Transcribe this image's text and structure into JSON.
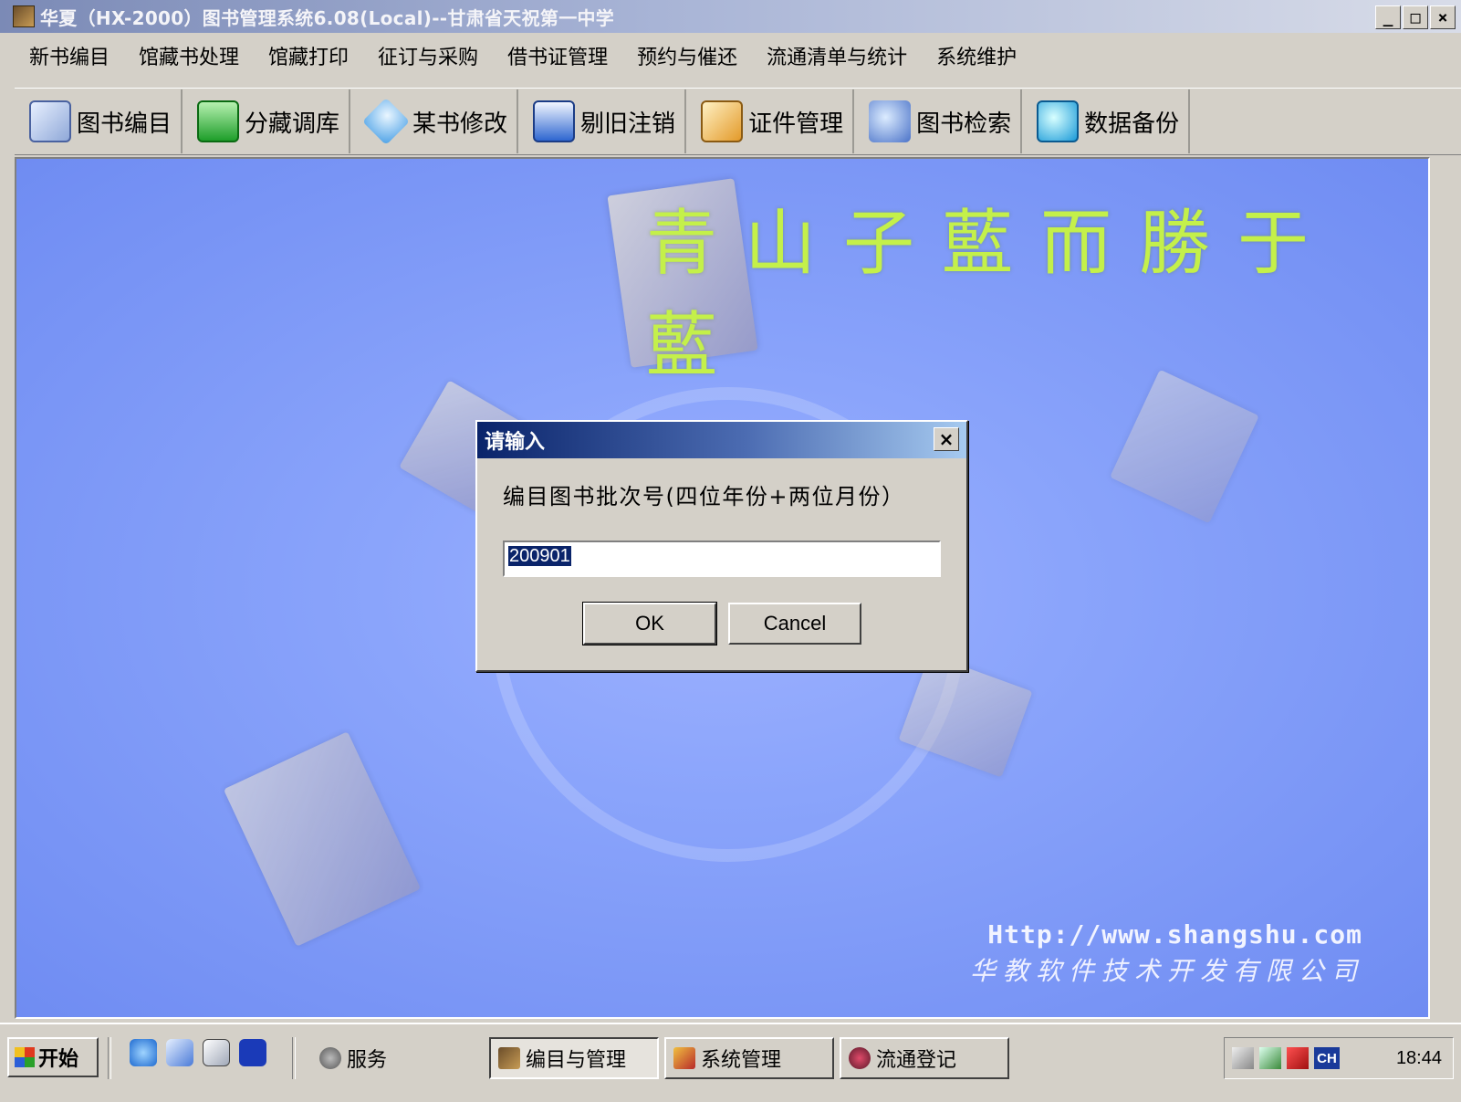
{
  "window": {
    "title": "华夏（HX-2000）图书管理系统6.08(Local)--甘肃省天祝第一中学",
    "min": "_",
    "max": "□",
    "close": "×"
  },
  "menu": {
    "items": [
      "新书编目",
      "馆藏书处理",
      "馆藏打印",
      "征订与采购",
      "借书证管理",
      "预约与催还",
      "流通清单与统计",
      "系统维护"
    ]
  },
  "toolbar": {
    "buttons": [
      {
        "label": "图书编目",
        "icon": "catalog-icon"
      },
      {
        "label": "分藏调库",
        "icon": "transfer-icon"
      },
      {
        "label": "某书修改",
        "icon": "edit-icon"
      },
      {
        "label": "剔旧注销",
        "icon": "weed-icon"
      },
      {
        "label": "证件管理",
        "icon": "card-icon"
      },
      {
        "label": "图书检索",
        "icon": "search-icon"
      },
      {
        "label": "数据备份",
        "icon": "backup-icon"
      }
    ]
  },
  "background": {
    "seal_text": "青山子藍而勝于藍",
    "url": "Http://www.shangshu.com",
    "company": "华教软件技术开发有限公司"
  },
  "dialog": {
    "title": "请输入",
    "close": "×",
    "prompt": "编目图书批次号(四位年份+两位月份）",
    "input_value": "200901",
    "ok_label": "OK",
    "cancel_label": "Cancel"
  },
  "taskbar": {
    "start_label": "开始",
    "service_label": "服务",
    "tasks": [
      "编目与管理",
      "系统管理",
      "流通登记"
    ],
    "lang": "CH",
    "clock": "18:44"
  }
}
